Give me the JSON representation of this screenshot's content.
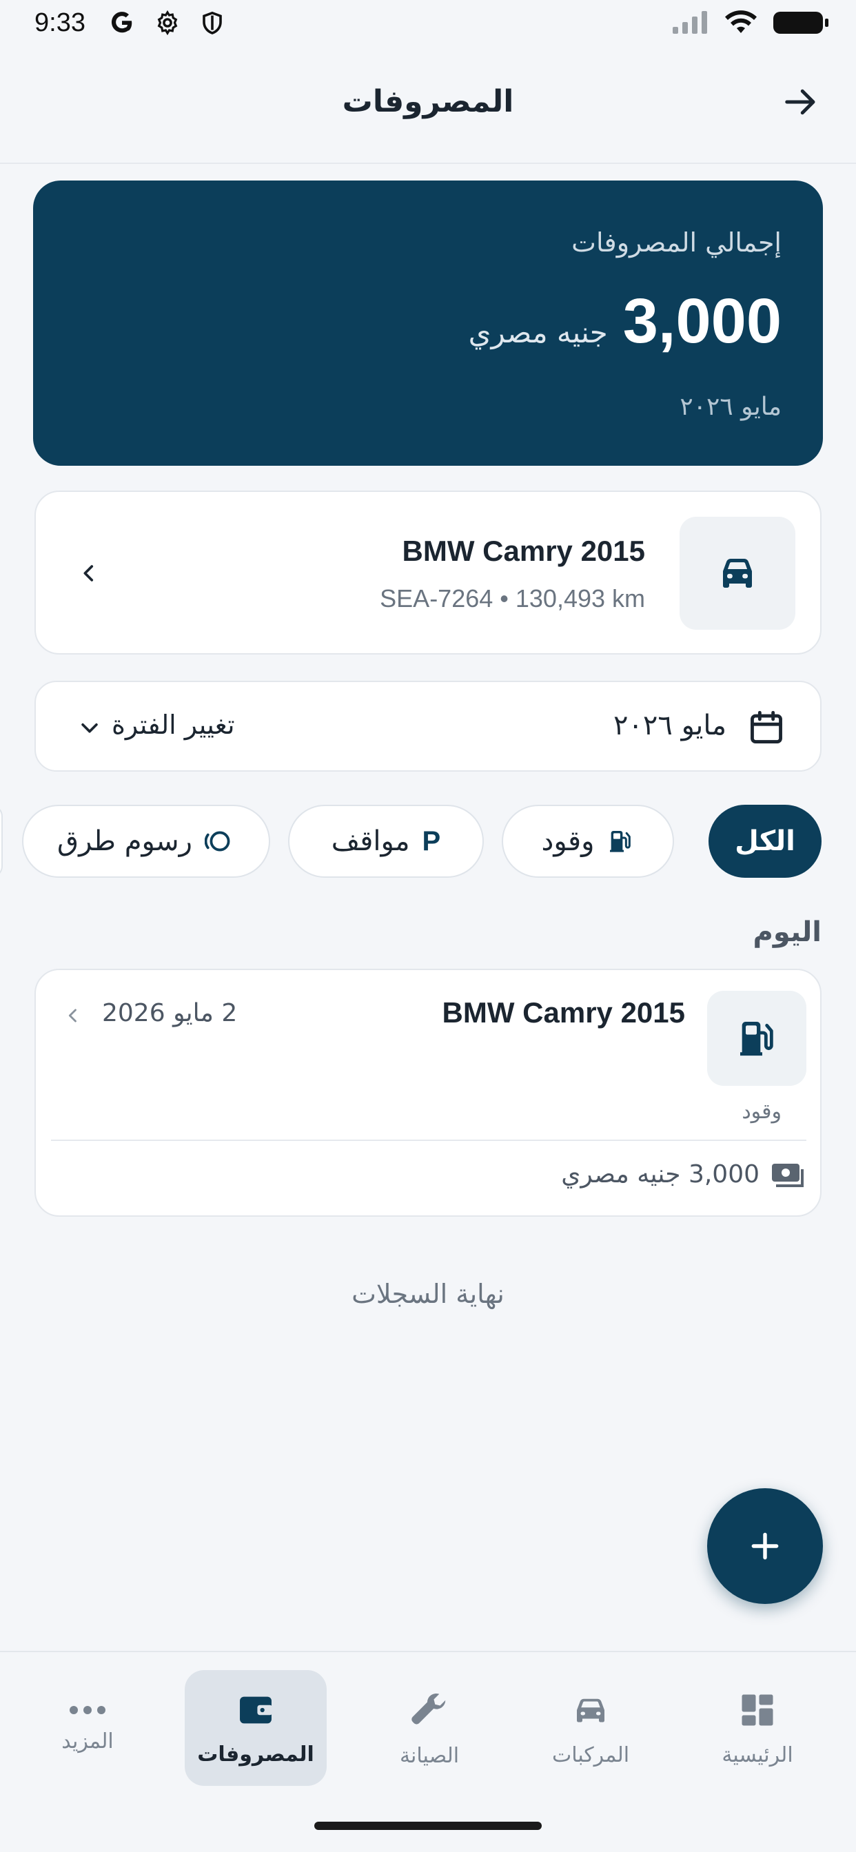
{
  "status_bar": {
    "time": "9:33",
    "left_icons": [
      "google-g-icon",
      "settings-gear-icon",
      "shield-icon"
    ],
    "right_icons": [
      "cellular-signal-icon",
      "wifi-icon",
      "battery-icon"
    ]
  },
  "header": {
    "title": "المصروفات",
    "back_icon": "arrow-right-icon"
  },
  "summary": {
    "label": "إجمالي المصروفات",
    "amount": "3,000",
    "currency": "جنيه مصري",
    "period": "مايو ٢٠٢٦"
  },
  "vehicle": {
    "name": "BMW Camry 2015",
    "meta": "SEA-7264 • 130,493 km",
    "icon": "car-icon"
  },
  "period_selector": {
    "value": "مايو ٢٠٢٦",
    "change_label": "تغيير الفترة"
  },
  "filters": {
    "all": "الكل",
    "fuel": "وقود",
    "parking": "مواقف",
    "parking_glyph": "P",
    "tolls": "رسوم طرق",
    "selected": "الكل"
  },
  "section": {
    "title": "اليوم"
  },
  "records": [
    {
      "vehicle": "BMW Camry 2015",
      "date": "2 مايو 2026",
      "category": "وقود",
      "amount": "3,000 جنيه مصري"
    }
  ],
  "end_of_list": "نهاية السجلات",
  "bottom_nav": {
    "home": "الرئيسية",
    "vehicles": "المركبات",
    "maintenance": "الصيانة",
    "expenses": "المصروفات",
    "more": "المزيد",
    "active": "المصروفات"
  },
  "colors": {
    "primary": "#0c3e5a",
    "background": "#f4f6f9",
    "card": "#ffffff"
  }
}
